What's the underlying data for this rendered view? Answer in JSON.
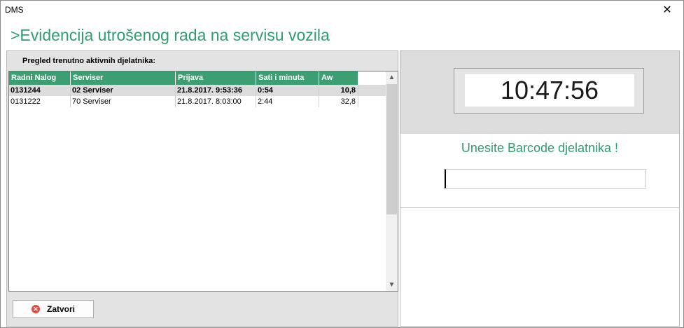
{
  "window": {
    "title": "DMS",
    "close_glyph": "✕"
  },
  "heading": ">Evidencija utrošenog rada na servisu vozila",
  "left": {
    "caption": "Pregled trenutno aktivnih djelatnika:",
    "columns": [
      "Radni Nalog",
      "Serviser",
      "Prijava",
      "Sati i minuta",
      "Aw"
    ],
    "rows": [
      [
        "0131244",
        "02 Serviser",
        "21.8.2017. 9:53:36",
        "0:54",
        "10,8"
      ],
      [
        "0131222",
        "70 Serviser",
        "21.8.2017. 8:03:00",
        "2:44",
        "32,8"
      ]
    ],
    "close_button": "Zatvori"
  },
  "right": {
    "clock": "10:47:56",
    "barcode_label": "Unesite Barcode djelatnika !",
    "barcode_value": ""
  },
  "icons": {
    "close": "close-icon",
    "scroll_up": "scroll-up-icon",
    "scroll_down": "scroll-down-icon"
  },
  "colors": {
    "accent": "#2e9e6e",
    "header_bg": "#3c9f72"
  }
}
